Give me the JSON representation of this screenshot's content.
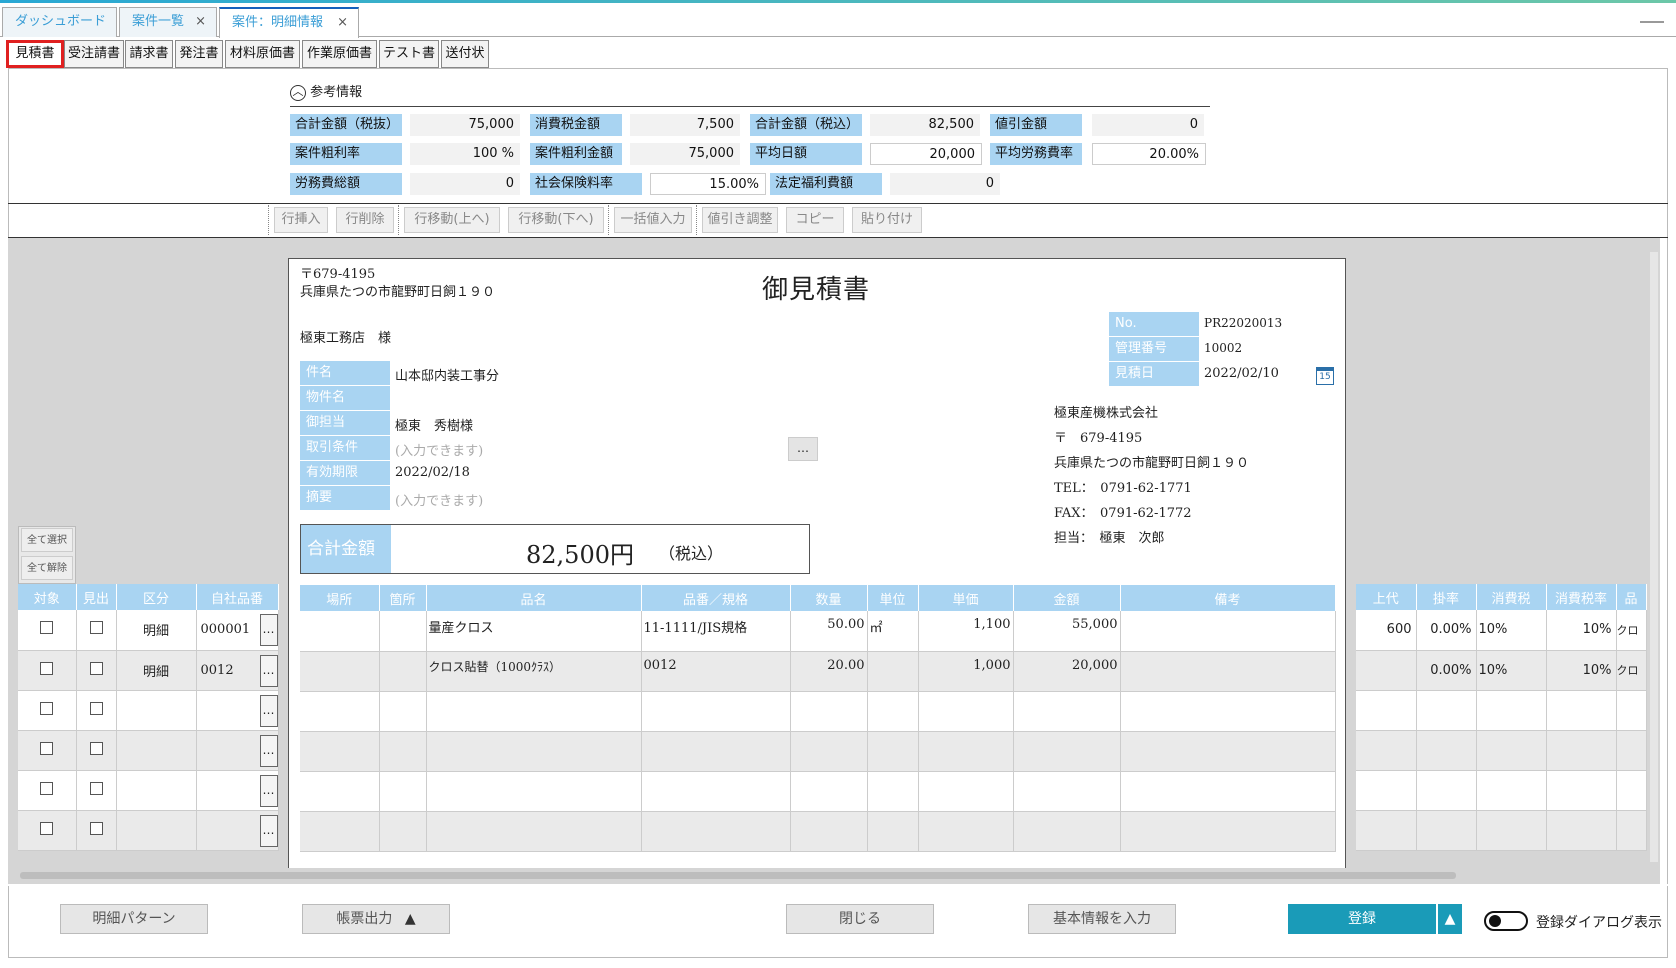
{
  "window_tabs": [
    {
      "label": "ダッシュボード",
      "closable": false
    },
    {
      "label": "案件一覧",
      "closable": true
    },
    {
      "label": "案件：明細情報",
      "closable": true,
      "active": true
    }
  ],
  "doc_tabs": [
    "見積書",
    "受注請書",
    "請求書",
    "発注書",
    "材料原価書",
    "作業原価書",
    "テスト書",
    "送付状"
  ],
  "ref": {
    "heading": "参考情報",
    "rows": [
      [
        {
          "label": "合計金額（税抜）",
          "value": "75,000"
        },
        {
          "label": "消費税金額",
          "value": "7,500"
        },
        {
          "label": "合計金額（税込）",
          "value": "82,500"
        },
        {
          "label": "値引金額",
          "value": "0"
        }
      ],
      [
        {
          "label": "案件粗利率",
          "value": "100 %"
        },
        {
          "label": "案件粗利金額",
          "value": "75,000"
        },
        {
          "label": "平均日額",
          "value": "20,000"
        },
        {
          "label": "平均労務費率",
          "value": "20.00%"
        }
      ],
      [
        {
          "label": "労務費総額",
          "value": "0"
        },
        {
          "label": "社会保険料率",
          "value": "15.00%"
        },
        {
          "label": "法定福利費額",
          "value": "0"
        }
      ]
    ]
  },
  "toolbar": [
    "行挿入",
    "行削除",
    "行移動(上へ)",
    "行移動(下へ)",
    "一括値入力",
    "値引き調整",
    "コピー",
    "貼り付け"
  ],
  "select_all": "全て選択",
  "deselect_all": "全て解除",
  "doc": {
    "postal": "〒679-4195",
    "address": "兵庫県たつの市龍野町日飼１９０",
    "title": "御見積書",
    "customer": "極東工務店　様",
    "fields": [
      {
        "label": "件名",
        "value": "山本邸内装工事分",
        "placeholder": false
      },
      {
        "label": "物件名",
        "value": "",
        "placeholder": false
      },
      {
        "label": "御担当",
        "value": "極東　秀樹様",
        "placeholder": false
      },
      {
        "label": "取引条件",
        "value": "(入力できます)",
        "placeholder": true
      },
      {
        "label": "有効期限",
        "value": "2022/02/18",
        "placeholder": false
      },
      {
        "label": "摘要",
        "value": "(入力できます)",
        "placeholder": true
      }
    ],
    "meta": [
      {
        "label": "No.",
        "value": "PR22020013"
      },
      {
        "label": "管理番号",
        "value": "10002"
      },
      {
        "label": "見積日",
        "value": "2022/02/10"
      }
    ],
    "calendar_day": "15",
    "company": [
      "極東産機株式会社",
      "〒　679-4195",
      "兵庫県たつの市龍野町日飼１９０",
      "TEL：　0791-62-1771",
      "FAX：　0791-62-1772",
      "担当：　極東　次郎"
    ],
    "total_label": "合計金額",
    "total_amount": "82,500円",
    "total_tax": "（税込）",
    "ellipsis": "…"
  },
  "left_grid": {
    "headers": [
      "対象",
      "見出",
      "区分",
      "自社品番"
    ],
    "rows": [
      [
        "明細",
        "000001"
      ],
      [
        "明細",
        "0012"
      ],
      [
        "",
        ""
      ],
      [
        "",
        ""
      ],
      [
        "",
        ""
      ],
      [
        "",
        ""
      ],
      [
        "",
        ""
      ]
    ]
  },
  "main_grid": {
    "headers": [
      "場所",
      "箇所",
      "品名",
      "品番／規格",
      "数量",
      "単位",
      "単価",
      "金額",
      "備考"
    ],
    "rows": [
      [
        "",
        "",
        "量産クロス",
        "11-1111/JIS規格",
        "50.00",
        "㎡",
        "1,100",
        "55,000",
        ""
      ],
      [
        "",
        "",
        "クロス貼替（1000ｸﾗｽ）",
        "0012",
        "20.00",
        "",
        "1,000",
        "20,000",
        ""
      ],
      [
        "",
        "",
        "",
        "",
        "",
        "",
        "",
        "",
        ""
      ],
      [
        "",
        "",
        "",
        "",
        "",
        "",
        "",
        "",
        ""
      ],
      [
        "",
        "",
        "",
        "",
        "",
        "",
        "",
        "",
        ""
      ],
      [
        "",
        "",
        "",
        "",
        "",
        "",
        "",
        "",
        ""
      ]
    ]
  },
  "right_grid": {
    "headers": [
      "上代",
      "掛率",
      "消費税",
      "消費税率",
      "品"
    ],
    "rows": [
      [
        "600",
        "0.00%",
        "10%",
        "10%",
        "クロ"
      ],
      [
        "",
        "0.00%",
        "10%",
        "10%",
        "クロ"
      ],
      [
        "",
        "",
        "",
        "",
        ""
      ],
      [
        "",
        "",
        "",
        "",
        ""
      ],
      [
        "",
        "",
        "",
        "",
        ""
      ],
      [
        "",
        "",
        "",
        "",
        ""
      ]
    ]
  },
  "bottom": {
    "pattern": "明細パターン",
    "print": "帳票出力",
    "close": "閉じる",
    "basic": "基本情報を入力",
    "register": "登録",
    "dialog_toggle": "登録ダイアログ表示"
  },
  "colors": {
    "accent": "#1a9bb8",
    "label_bg": "#a9d4f2",
    "tab_text": "#3b9ed6",
    "selected_border": "#e02020"
  }
}
